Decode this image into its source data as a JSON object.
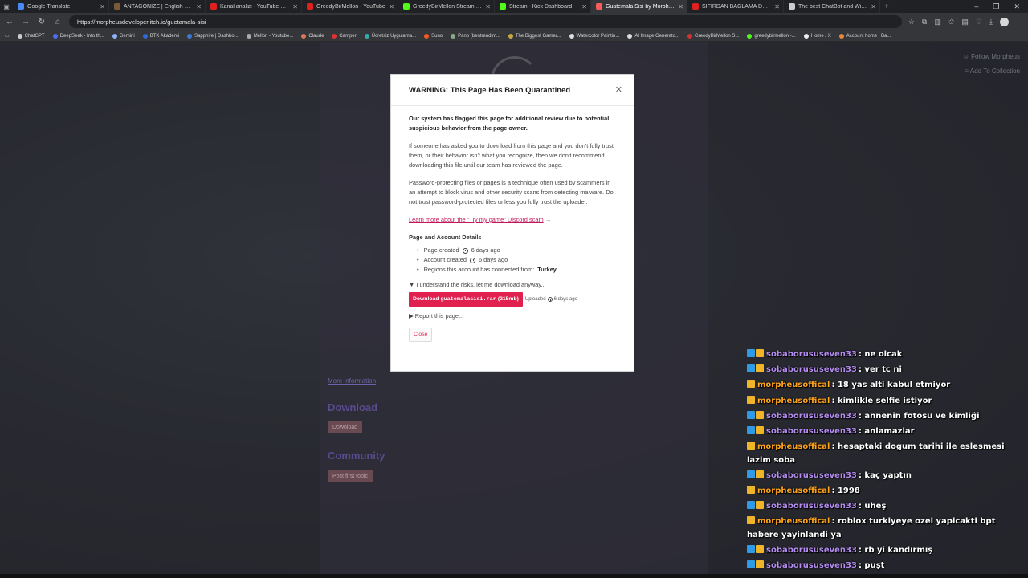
{
  "tabs": [
    {
      "title": "Google Translate",
      "color": "#4a8af4",
      "active": false
    },
    {
      "title": "ANTAGONIZE | English meaning - ",
      "color": "#7a5a3a",
      "active": false
    },
    {
      "title": "Kanal analizi - YouTube Studio",
      "color": "#e02020",
      "active": false
    },
    {
      "title": "GreedyBirMellon - YouTube",
      "color": "#e02020",
      "active": false
    },
    {
      "title": "GreedyBirMellon Stream - Watch L",
      "color": "#53fc18",
      "active": false
    },
    {
      "title": "Stream - Kick Dashboard",
      "color": "#53fc18",
      "active": false
    },
    {
      "title": "Guatemala Sisi by Morpheus",
      "color": "#fa5c5c",
      "active": true
    },
    {
      "title": "SIFIRDAN BAĞLAMA DERSİ 3 (EN",
      "color": "#e02020",
      "active": false
    },
    {
      "title": "The best ChatBot and Widgets for",
      "color": "#cccccc",
      "active": false
    }
  ],
  "address": {
    "url": "https://morpheusdeveloper.itch.io/guetamala-sisi"
  },
  "bookmarks": [
    {
      "label": "ChatGPT",
      "color": "#cccccc"
    },
    {
      "label": "DeepSeek - Into th...",
      "color": "#4d6bfe"
    },
    {
      "label": "Gemini",
      "color": "#8ab4f8"
    },
    {
      "label": "BTK Akademi",
      "color": "#2d6ad8"
    },
    {
      "label": "Sapphire | Dashbo...",
      "color": "#3b7bd6"
    },
    {
      "label": "Mellon - Youtube...",
      "color": "#aaaaaa"
    },
    {
      "label": "Claude",
      "color": "#d97757"
    },
    {
      "label": "Camper",
      "color": "#d33"
    },
    {
      "label": "Ücretsiz Uygulama...",
      "color": "#3aa"
    },
    {
      "label": "Suno",
      "color": "#f05a28"
    },
    {
      "label": "Pano (bentrendim...",
      "color": "#8a8"
    },
    {
      "label": "The Biggest Gamer...",
      "color": "#caa640"
    },
    {
      "label": "Watercolor Paintin...",
      "color": "#ddd"
    },
    {
      "label": "AI Image Generato...",
      "color": "#ddd"
    },
    {
      "label": "GreedyBirMellon S...",
      "color": "#c33"
    },
    {
      "label": "greedybirmellon -...",
      "color": "#53fc18"
    },
    {
      "label": "Home / X",
      "color": "#eee"
    },
    {
      "label": "Account home | Ba...",
      "color": "#e88a3a"
    }
  ],
  "page": {
    "follow_label": "Follow Morpheus",
    "collection_label": "Add To Collection",
    "more_info": "More information",
    "download_heading": "Download",
    "download_btn": "Download",
    "community_heading": "Community",
    "post_topic_btn": "Post first topic"
  },
  "modal": {
    "title": "WARNING: This Page Has Been Quarantined",
    "lead": "Our system has flagged this page for additional review due to potential suspicious behavior from the page owner.",
    "para1": "If someone has asked you to download from this page and you don't fully trust them, or their behavior isn't what you recognize, then we don't recommend downloading this file until our team has reviewed the page.",
    "para2": "Password-protecting files or pages is a technique often used by scammers in an attempt to block virus and other security scans from detecting malware. Do not trust password-protected files unless you fully trust the uploader.",
    "scam_link": "Learn more about the \"Try my game\" Discord scam",
    "details_heading": "Page and Account Details",
    "page_created_label": "Page created",
    "page_created_value": "6 days ago",
    "account_created_label": "Account created",
    "account_created_value": "6 days ago",
    "regions_label": "Regions this account has connected from:",
    "regions_value": "Turkey",
    "understand_label": "I understand the risks, let me download anyway...",
    "download_prefix": "Download",
    "download_file": "guatemalasisi.rar",
    "download_size": "(215mb)",
    "uploaded_label": "Uploaded",
    "uploaded_value": "6 days ago",
    "report_label": "Report this page...",
    "close_label": "Close"
  },
  "chat": [
    {
      "user": "sobaborususeven33",
      "badges": [
        "mod",
        "sub"
      ],
      "color": "purple",
      "text": ": ne olcak"
    },
    {
      "user": "sobaborususeven33",
      "badges": [
        "mod",
        "sub"
      ],
      "color": "purple",
      "text": ": ver tc ni"
    },
    {
      "user": "morpheusoffical",
      "badges": [
        "sub"
      ],
      "color": "orange",
      "text": ": 18 yas alti kabul etmiyor"
    },
    {
      "user": "morpheusoffical",
      "badges": [
        "sub"
      ],
      "color": "orange",
      "text": ": kimlikle selfie istiyor"
    },
    {
      "user": "sobaborususeven33",
      "badges": [
        "mod",
        "sub"
      ],
      "color": "purple",
      "text": ": annenin fotosu ve kimliği"
    },
    {
      "user": "sobaborususeven33",
      "badges": [
        "mod",
        "sub"
      ],
      "color": "purple",
      "text": ": anlamazlar"
    },
    {
      "user": "morpheusoffical",
      "badges": [
        "sub"
      ],
      "color": "orange",
      "text": ": hesaptaki dogum tarihi ile eslesmesi lazim soba"
    },
    {
      "user": "sobaborususeven33",
      "badges": [
        "mod",
        "sub"
      ],
      "color": "purple",
      "text": ": kaç yaptın"
    },
    {
      "user": "morpheusoffical",
      "badges": [
        "sub"
      ],
      "color": "orange",
      "text": ": 1998"
    },
    {
      "user": "sobaborususeven33",
      "badges": [
        "mod",
        "sub"
      ],
      "color": "purple",
      "text": ": uheş"
    },
    {
      "user": "morpheusoffical",
      "badges": [
        "sub"
      ],
      "color": "orange",
      "text": ": roblox turkiyeye ozel yapicakti bpt habere yayinlandi ya"
    },
    {
      "user": "sobaborususeven33",
      "badges": [
        "mod",
        "sub"
      ],
      "color": "purple",
      "text": ": rb yi kandırmış"
    },
    {
      "user": "sobaborususeven33",
      "badges": [
        "mod",
        "sub"
      ],
      "color": "purple",
      "text": ": puşt"
    }
  ]
}
